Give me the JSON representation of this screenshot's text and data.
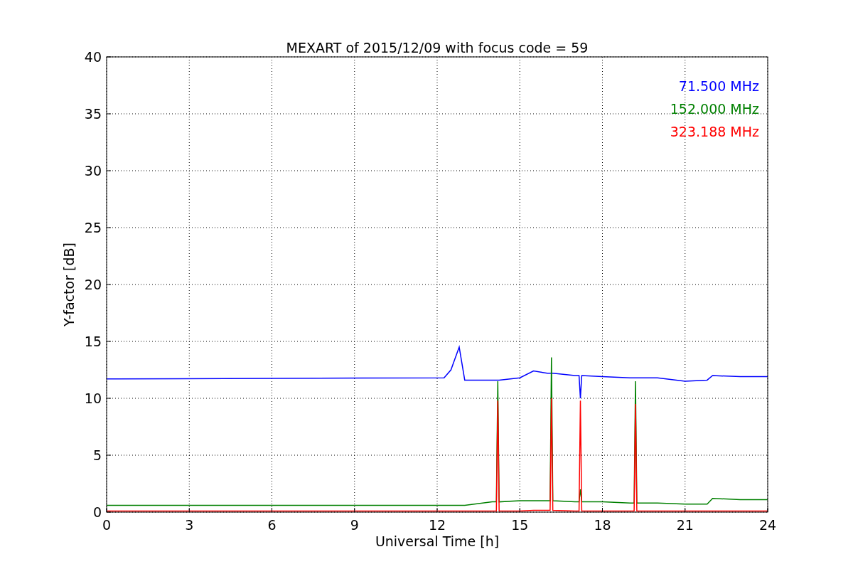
{
  "chart_data": {
    "type": "line",
    "title": "MEXART of 2015/12/09 with focus code = 59",
    "xlabel": "Universal Time [h]",
    "ylabel": "Y-factor [dB]",
    "x": [
      0,
      0.3,
      12.25,
      12.5,
      12.8,
      13,
      14,
      14.15,
      14.2,
      14.25,
      15,
      15.5,
      16,
      16.1,
      16.15,
      16.2,
      17,
      17.15,
      17.2,
      17.25,
      18,
      19,
      19.15,
      19.2,
      19.25,
      20,
      21,
      21.8,
      22,
      23,
      24
    ],
    "series": [
      {
        "name": "71.500 MHz",
        "color": "#0000ff",
        "values": [
          11.7,
          11.7,
          11.8,
          12.5,
          14.5,
          11.6,
          11.6,
          11.6,
          11.6,
          11.6,
          11.8,
          12.4,
          12.2,
          12.2,
          12.2,
          12.2,
          12.0,
          12.0,
          10.0,
          12.0,
          11.9,
          11.8,
          11.8,
          11.8,
          11.8,
          11.8,
          11.5,
          11.6,
          12.0,
          11.9,
          11.9
        ]
      },
      {
        "name": "152.000 MHz",
        "color": "#008000",
        "values": [
          0.6,
          0.6,
          0.6,
          0.6,
          0.6,
          0.6,
          0.9,
          0.9,
          11.5,
          0.9,
          1.0,
          1.0,
          1.0,
          1.0,
          13.6,
          1.0,
          0.9,
          0.9,
          2.0,
          0.9,
          0.9,
          0.8,
          0.8,
          11.5,
          0.8,
          0.8,
          0.7,
          0.7,
          1.2,
          1.1,
          1.1
        ]
      },
      {
        "name": "323.188 MHz",
        "color": "#ff0000",
        "values": [
          0.1,
          0.1,
          0.1,
          0.1,
          0.1,
          0.1,
          0.1,
          0.1,
          9.8,
          0.1,
          0.1,
          0.15,
          0.15,
          0.15,
          10.0,
          0.15,
          0.1,
          0.1,
          9.8,
          0.1,
          0.1,
          0.1,
          0.1,
          9.5,
          0.1,
          0.1,
          0.1,
          0.1,
          0.1,
          0.1,
          0.1
        ]
      }
    ],
    "grid": true,
    "xlim": [
      0,
      24
    ],
    "ylim": [
      0,
      40
    ],
    "xticks": [
      0,
      3,
      6,
      9,
      12,
      15,
      18,
      21,
      24
    ],
    "yticks": [
      0,
      5,
      10,
      15,
      20,
      25,
      30,
      35,
      40
    ]
  }
}
